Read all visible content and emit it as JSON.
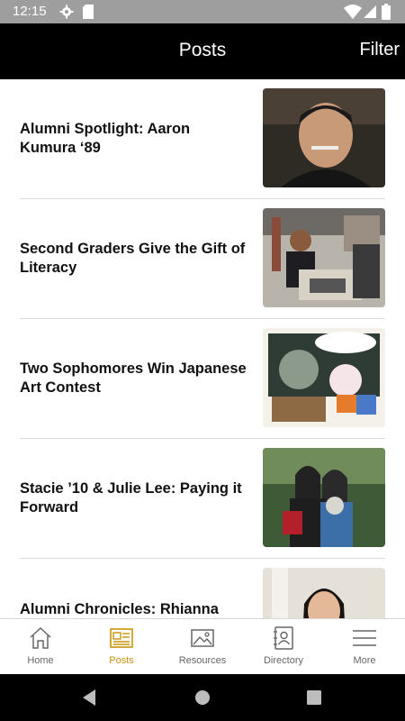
{
  "status_bar": {
    "time": "12:15"
  },
  "app_bar": {
    "title": "Posts",
    "filter_label": "Filter"
  },
  "posts": [
    {
      "title": "Alumni Spotlight: Aaron Kumura ‘89"
    },
    {
      "title": "Second Graders Give the Gift of Literacy"
    },
    {
      "title": "Two Sophomores Win Japanese Art Contest"
    },
    {
      "title": "Stacie ’10 & Julie Lee: Paying it Forward"
    },
    {
      "title": "Alumni Chronicles: Rhianna"
    }
  ],
  "tabs": [
    {
      "label": "Home",
      "icon": "home-icon"
    },
    {
      "label": "Posts",
      "icon": "posts-icon",
      "active": true
    },
    {
      "label": "Resources",
      "icon": "image-icon"
    },
    {
      "label": "Directory",
      "icon": "directory-icon"
    },
    {
      "label": "More",
      "icon": "menu-icon"
    }
  ],
  "colors": {
    "accent": "#c8930c",
    "app_bar": "#000000",
    "status_bar": "#9e9e9e"
  }
}
